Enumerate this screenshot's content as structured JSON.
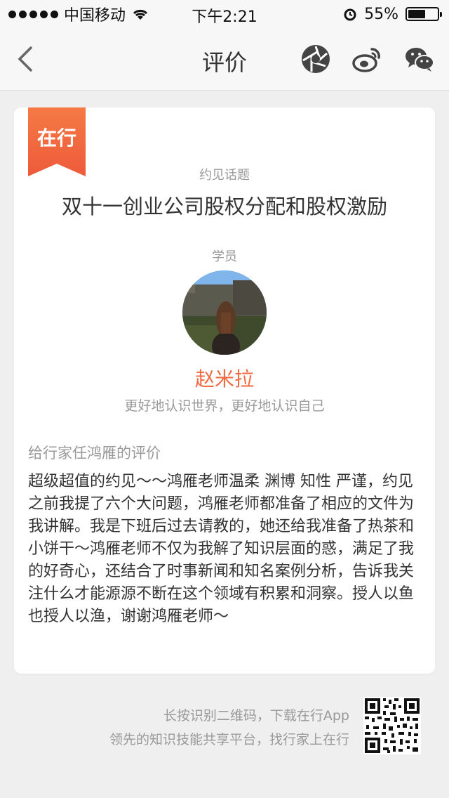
{
  "status_bar": {
    "carrier": "中国移动",
    "time": "下午2:21",
    "battery": "55%"
  },
  "nav": {
    "title": "评价",
    "icons": [
      "back-icon",
      "aperture-icon",
      "weibo-icon",
      "wechat-icon"
    ]
  },
  "card": {
    "ribbon_label": "在行",
    "topic_label": "约见话题",
    "topic_title": "双十一创业公司股权分配和股权激励",
    "student_label": "学员",
    "student_name": "赵米拉",
    "student_motto": "更好地认识世界，更好地认识自己",
    "review_heading": "给行家任鸿雁的评价",
    "review_text": "超级超值的约见～～鸿雁老师温柔 渊博 知性 严谨，约见之前我提了六个大问题，鸿雁老师都准备了相应的文件为我讲解。我是下班后过去请教的，她还给我准备了热茶和小饼干～鸿雁老师不仅为我解了知识层面的惑，满足了我的好奇心，还结合了时事新闻和知名案例分析，告诉我关注什么才能源源不断在这个领域有积累和洞察。授人以鱼也授人以渔，谢谢鸿雁老师～"
  },
  "footer": {
    "line1": "长按识别二维码，下载在行App",
    "line2": "领先的知识技能共享平台，找行家上在行"
  },
  "colors": {
    "accent": "#f06a42",
    "ribbon": "#f26c40",
    "background": "#efefef"
  }
}
